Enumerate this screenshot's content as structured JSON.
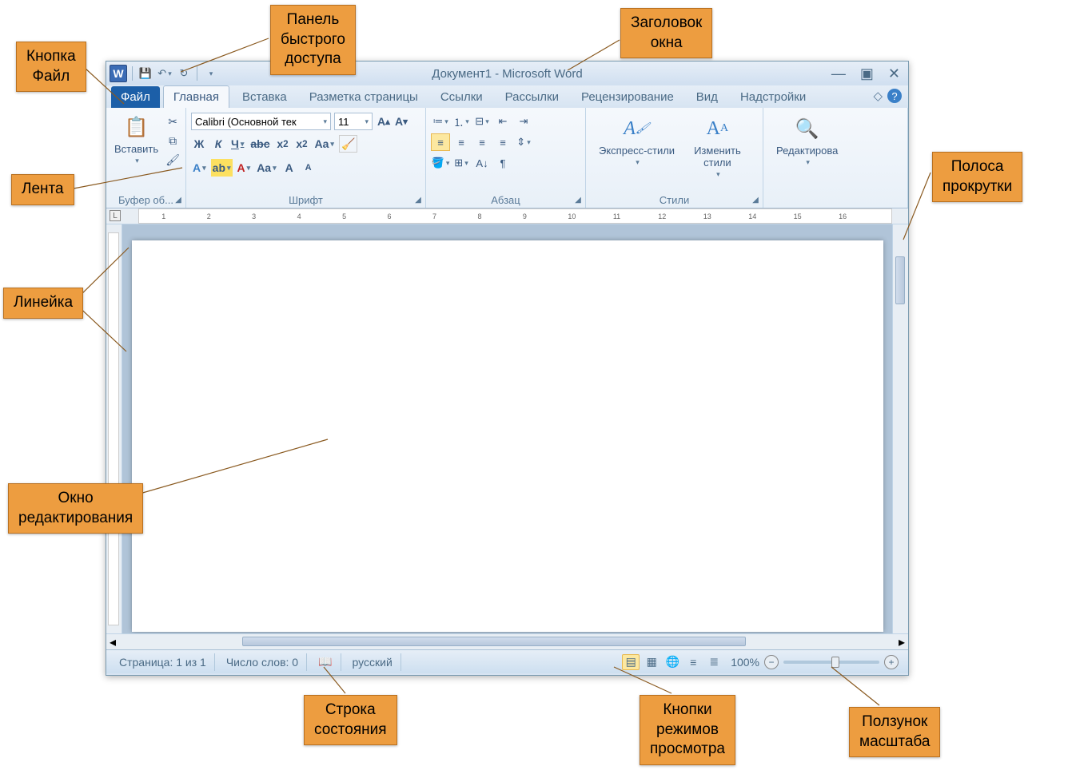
{
  "callouts": {
    "file_btn": "Кнопка\nФайл",
    "qat": "Панель\nбыстрого\nдоступа",
    "title": "Заголовок\nокна",
    "ribbon": "Лента",
    "ruler": "Линейка",
    "edit_window": "Окно\nредактирования",
    "scrollbar": "Полоса\nпрокрутки",
    "statusbar": "Строка\nсостояния",
    "view_buttons": "Кнопки\nрежимов\nпросмотра",
    "zoom_slider": "Ползунок\nмасштаба"
  },
  "titlebar": {
    "doc": "Документ1",
    "sep": "-",
    "app": "Microsoft Word"
  },
  "tabs": {
    "file": "Файл",
    "home": "Главная",
    "insert": "Вставка",
    "layout": "Разметка страницы",
    "refs": "Ссылки",
    "mail": "Рассылки",
    "review": "Рецензирование",
    "view": "Вид",
    "addins": "Надстройки"
  },
  "ribbon": {
    "clipboard": {
      "paste": "Вставить",
      "label": "Буфер об..."
    },
    "font": {
      "name": "Calibri (Основной тек",
      "size": "11",
      "label": "Шрифт"
    },
    "paragraph": {
      "label": "Абзац"
    },
    "styles": {
      "express": "Экспресс-стили",
      "change": "Изменить\nстили",
      "label": "Стили"
    },
    "editing": {
      "edit": "Редактирова",
      "label": ""
    }
  },
  "ruler": {
    "tab": "L",
    "marks": [
      "1",
      "2",
      "3",
      "4",
      "5",
      "6",
      "7",
      "8",
      "9",
      "10",
      "11",
      "12",
      "13",
      "14",
      "15",
      "16"
    ]
  },
  "statusbar": {
    "page": "Страница: 1 из 1",
    "words": "Число слов: 0",
    "lang": "русский",
    "zoom": "100%"
  }
}
